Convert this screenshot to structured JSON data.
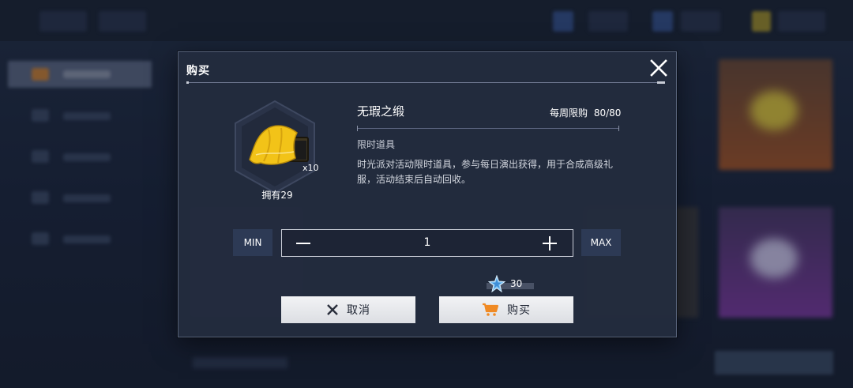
{
  "dialog": {
    "title": "购买",
    "item": {
      "name": "无瑕之缎",
      "count_label": "x10",
      "owned_label": "拥有29",
      "weekly_limit_label": "每周限购",
      "weekly_limit_value": "80/80",
      "type": "限时道具",
      "description": "时光派对活动限时道具，参与每日演出获得，用于合成高级礼服，活动结束后自动回收。"
    },
    "quantity": {
      "min_label": "MIN",
      "max_label": "MAX",
      "value": "1"
    },
    "cost": {
      "value": "30",
      "currency_icon": "crystal-star-icon"
    },
    "buttons": {
      "cancel_label": "取消",
      "buy_label": "购买"
    }
  },
  "colors": {
    "cart_orange": "#f08a24",
    "gold_item": "#f2c318",
    "dialog_bg": "#242c3e"
  }
}
